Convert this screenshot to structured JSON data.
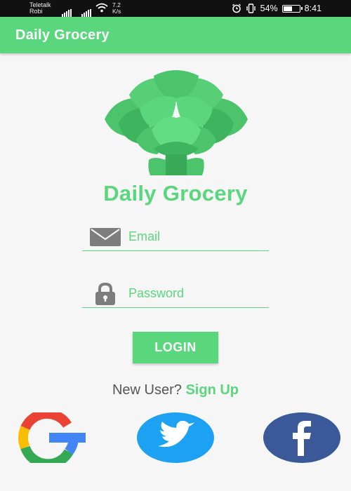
{
  "status_bar": {
    "carrier_1": "Teletalk",
    "carrier_2": "Robi",
    "speed_value": "7.2",
    "speed_unit": "K/s",
    "battery": "54%",
    "time": "8:41"
  },
  "app_bar": {
    "title": "Daily Grocery"
  },
  "headline": "Daily Grocery",
  "form": {
    "email_placeholder": "Email",
    "email_value": "",
    "password_placeholder": "Password",
    "password_value": "",
    "login_label": "LOGIN"
  },
  "signup": {
    "prompt": "New User?",
    "link": "Sign Up"
  },
  "social": {
    "google_icon": "google-icon",
    "twitter_icon": "twitter-icon",
    "facebook_icon": "facebook-icon"
  },
  "colors": {
    "accent": "#5ad77c",
    "google_red": "#ea4335",
    "google_yellow": "#fbbc05",
    "google_green": "#34a853",
    "google_blue": "#4285f4",
    "twitter_blue": "#1da1f2",
    "facebook_blue": "#3b5998"
  }
}
